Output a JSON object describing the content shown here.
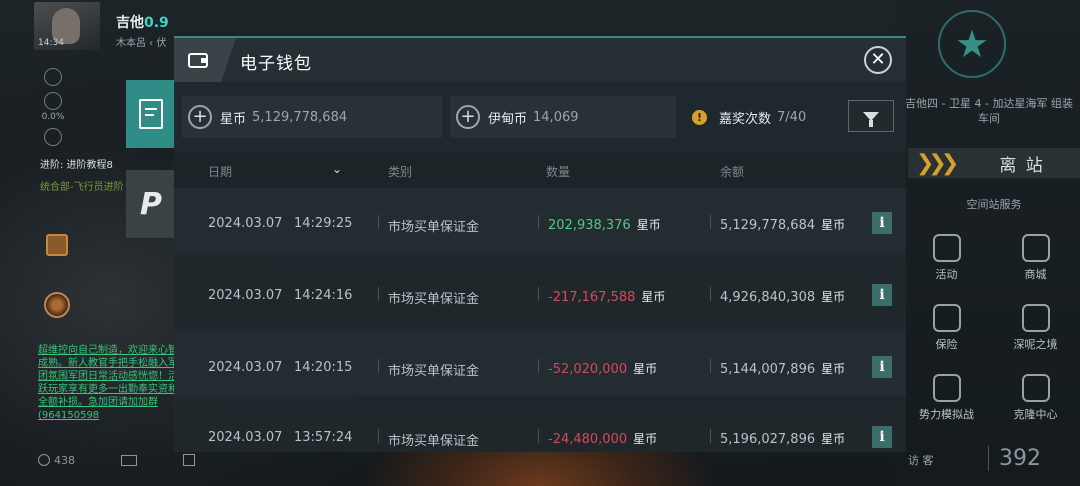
{
  "player": {
    "name": "吉他",
    "version": "0.9",
    "subtitle": "木本呂 ‹ 伏",
    "time": "14:34",
    "signal_pct": "0.0%"
  },
  "task": {
    "progress": "进阶: 进阶教程8",
    "sub": "统合部-飞行员进阶"
  },
  "chat": {
    "text": "超维控向自己制造，欢迎来心智成熟。新人教官手把手松融入军团氛围军团日常活动感恍惚！活跃玩家享有更多一出勤奉实资和全额补损。急加团请加加群(964150598"
  },
  "bottom_left": {
    "online_count": "438"
  },
  "right_panel": {
    "location": "吉他四 - 卫星 4 - 加达星海军 组装车间",
    "undock_label": "离 站",
    "station_services": "空间站服务",
    "services": [
      "活动",
      "商城",
      "保险",
      "深呢之境",
      "势力模拟战",
      "克隆中心"
    ],
    "visitor_label": "访 客",
    "visitor_count": "392"
  },
  "wallet": {
    "title": "电子钱包",
    "currencies": {
      "star": {
        "label": "星币",
        "value": "5,129,778,684"
      },
      "ydc": {
        "label": "伊甸币",
        "value": "14,069"
      }
    },
    "reward": {
      "label": "嘉奖次数",
      "value": "7/40"
    },
    "columns": {
      "date": "日期",
      "category": "类别",
      "amount": "数量",
      "balance": "余额"
    },
    "rows": [
      {
        "date": "2024.03.07",
        "time": "14:29:25",
        "category": "市场买单保证金",
        "amount": "202,938,376",
        "unit": "星币",
        "balance": "5,129,778,684",
        "balance_unit": "星币"
      },
      {
        "date": "2024.03.07",
        "time": "14:24:16",
        "category": "市场买单保证金",
        "amount": "-217,167,588",
        "unit": "星币",
        "balance": "4,926,840,308",
        "balance_unit": "星币"
      },
      {
        "date": "2024.03.07",
        "time": "14:20:15",
        "category": "市场买单保证金",
        "amount": "-52,020,000",
        "unit": "星币",
        "balance": "5,144,007,896",
        "balance_unit": "星币"
      },
      {
        "date": "2024.03.07",
        "time": "13:57:24",
        "category": "市场买单保证金",
        "amount": "-24,480,000",
        "unit": "星币",
        "balance": "5,196,027,896",
        "balance_unit": "星币"
      }
    ]
  },
  "icons": {
    "wallet": "wallet-icon",
    "close": "close-icon",
    "plus": "plus-icon",
    "warning": "warning-icon",
    "filter": "filter-icon",
    "sort": "chevron-down-icon",
    "info": "info-icon",
    "document": "document-icon",
    "p_tab": "p-logo-icon"
  },
  "colors": {
    "accent": "#2f8c86",
    "positive": "#53c787",
    "negative": "#d8475c",
    "warning": "#d8a02a"
  }
}
